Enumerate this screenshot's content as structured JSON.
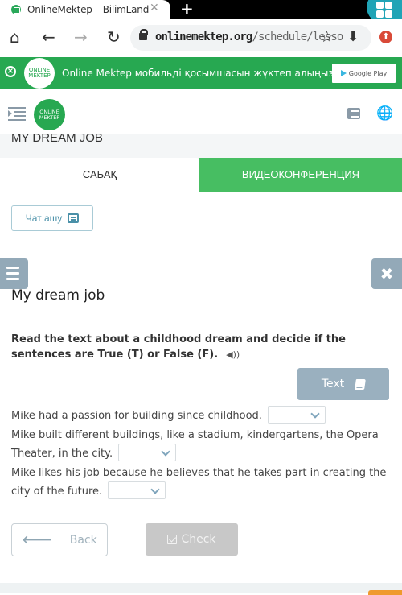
{
  "browser": {
    "tab_title": "OnlineMektep – BilimLand",
    "tab_close_icon": "close-icon",
    "new_tab_icon": "plus-icon",
    "apps_icon": "grid-icon",
    "nav": {
      "home_icon": "home-icon",
      "back_icon": "arrow-left-icon",
      "forward_icon": "arrow-right-icon",
      "reload_icon": "reload-icon"
    },
    "url_host": "onlinemektep.org",
    "url_path": "/schedule/lesso",
    "bookmark_icon": "star-icon",
    "download_icon": "download-icon",
    "extension_icon": "upload-icon"
  },
  "banner": {
    "close_icon": "close-circle-icon",
    "logo_line1": "ONLINE",
    "logo_line2": "MEKTEP",
    "text": "Online Mektep мобильді қосымшасын жүктеп алыңыз",
    "store_button": "Google Play"
  },
  "header": {
    "logo_line1": "ONLINE",
    "logo_line2": "MEKTEP",
    "menu_icon": "menu-collapse-icon",
    "list_icon": "list-icon",
    "globe_icon": "globe-icon"
  },
  "lesson": {
    "title": "MY DREAM JOB",
    "tabs": [
      {
        "label": "САБАҚ",
        "active": true
      },
      {
        "label": "ВИДЕОКОНФЕРЕНЦИЯ",
        "active": false
      }
    ],
    "chat_button": "Чат ашу"
  },
  "exercise": {
    "title": "My dream job",
    "instruction": "Read the text about a childhood dream and decide if the sentences are True (T) or False (F).",
    "text_button": "Text",
    "questions": [
      {
        "text": "Mike had a passion for building since childhood.",
        "selected": ""
      },
      {
        "text": "Mike built different buildings, like a stadium, kindergartens, the Opera Theater, in the city.",
        "selected": ""
      },
      {
        "text": "Mike likes his job because he believes that he takes part in creating the city of the future.",
        "selected": ""
      }
    ],
    "back_button": "Back",
    "check_button": "Check"
  },
  "colors": {
    "brand_green": "#27a851",
    "tab_green": "#47be62",
    "slate_button": "#9ab0bf",
    "disabled_button": "#c8c8c8",
    "accent_orange": "#ef9a2e"
  }
}
